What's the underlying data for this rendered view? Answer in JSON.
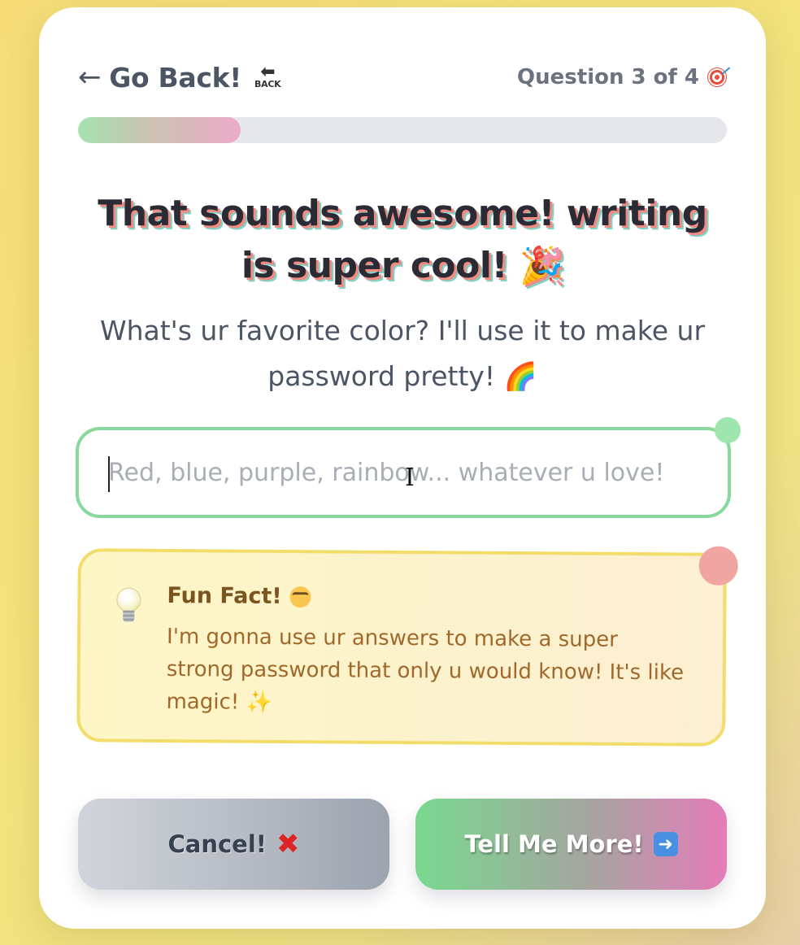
{
  "topbar": {
    "back_label": "Go Back!",
    "back_arrow": "←",
    "back_emoji_text": "BACK",
    "question_counter": "Question 3 of 4"
  },
  "progress": {
    "value": 0.25,
    "fill_colors": [
      "#a6e3b0",
      "#ebaac8"
    ]
  },
  "main": {
    "heading": "That sounds awesome! writing is super cool! 🎉",
    "question": "What's ur favorite color? I'll use it to make ur password pretty! 🌈"
  },
  "answer_input": {
    "value": "",
    "placeholder": "Red, blue, purple, rainbow... whatever u love!"
  },
  "fun_fact": {
    "title": "Fun Fact!",
    "body": "I'm gonna use ur answers to make a super strong password that only u would know! It's like magic!",
    "sparkle": "✨"
  },
  "buttons": {
    "cancel_label": "Cancel!",
    "next_label": "Tell Me More!"
  },
  "icons": {
    "back": "back-arrow-icon",
    "target": "target-icon",
    "bulb": "lightbulb-icon",
    "nerd": "nerd-face-icon",
    "cancel": "cross-mark-icon",
    "next": "right-arrow-icon"
  },
  "colors": {
    "accent_green": "#86d99a",
    "accent_pink": "#e47cb8",
    "fact_border": "#f2dc6a",
    "fact_text": "#a0692b"
  }
}
